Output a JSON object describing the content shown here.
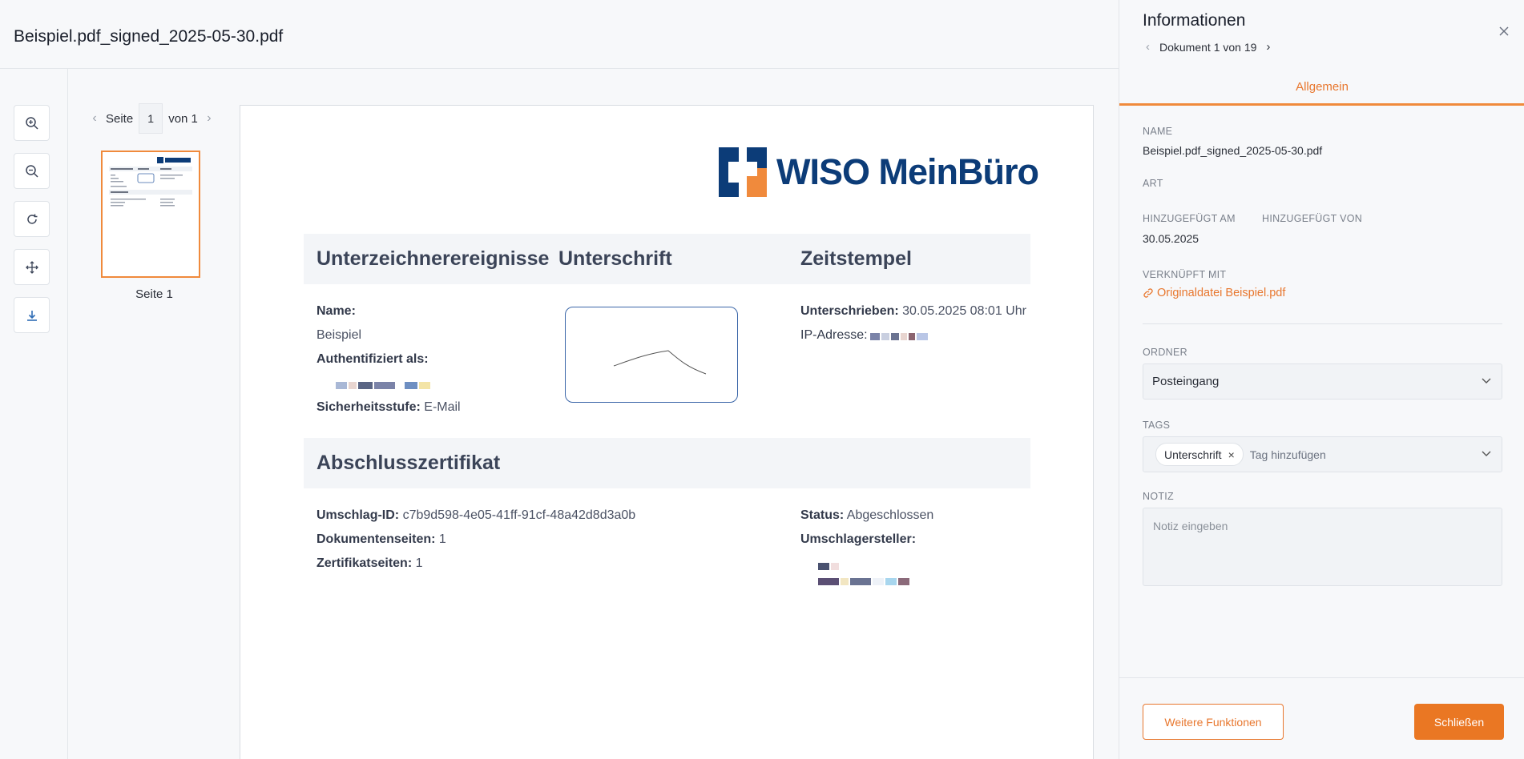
{
  "document": {
    "title": "Beispiel.pdf_signed_2025-05-30.pdf"
  },
  "toolbar": {
    "tools": [
      {
        "name": "zoom-in-icon"
      },
      {
        "name": "zoom-out-icon"
      },
      {
        "name": "rotate-icon"
      },
      {
        "name": "move-icon"
      },
      {
        "name": "download-icon"
      }
    ]
  },
  "pager": {
    "prefix": "Seite",
    "current": "1",
    "suffix": "von 1"
  },
  "thumbnail": {
    "label": "Seite 1"
  },
  "pdf": {
    "logo_text": "WISO MeinBüro",
    "section1": {
      "col1": "Unterzeichnerereignisse",
      "col2": "Unterschrift",
      "col3": "Zeitstempel"
    },
    "name_label": "Name:",
    "name_value": "Beispiel",
    "auth_label": "Authentifiziert als:",
    "security_label": "Sicherheitsstufe:",
    "security_value": "E-Mail",
    "signed_label": "Unterschrieben:",
    "signed_value": "30.05.2025 08:01 Uhr",
    "ip_label": "IP-Adresse:",
    "section2_title": "Abschlusszertifikat",
    "envelope_label": "Umschlag-ID:",
    "envelope_value": "c7b9d598-4e05-41ff-91cf-48a42d8d3a0b",
    "docpages_label": "Dokumentenseiten:",
    "docpages_value": "1",
    "certpages_label": "Zertifikatseiten:",
    "certpages_value": "1",
    "status_label": "Status:",
    "status_value": "Abgeschlossen",
    "creator_label": "Umschlagersteller:"
  },
  "panel": {
    "title": "Informationen",
    "doc_nav": "Dokument 1 von 19",
    "tab": "Allgemein",
    "name_label": "NAME",
    "name_value": "Beispiel.pdf_signed_2025-05-30.pdf",
    "type_label": "ART",
    "added_on_label": "HINZUGEFÜGT AM",
    "added_on_value": "30.05.2025",
    "added_by_label": "HINZUGEFÜGT VON",
    "linked_label": "VERKNÜPFT MIT",
    "linked_value": "Originaldatei Beispiel.pdf",
    "folder_label": "ORDNER",
    "folder_value": "Posteingang",
    "tags_label": "TAGS",
    "tags": [
      "Unterschrift"
    ],
    "tag_placeholder": "Tag hinzufügen",
    "note_label": "NOTIZ",
    "note_placeholder": "Notiz eingeben",
    "more_button": "Weitere Funktionen",
    "close_button": "Schließen"
  },
  "colors": {
    "accent": "#ea7723",
    "brand_blue": "#0c3c78"
  }
}
